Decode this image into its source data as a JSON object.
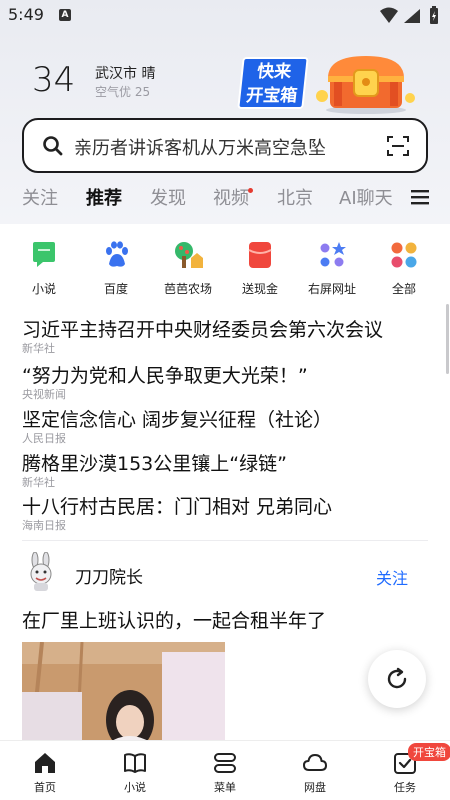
{
  "status_bar": {
    "time": "5:49",
    "notification_letter": "A"
  },
  "weather": {
    "temperature": "34",
    "city_condition": "武汉市 晴",
    "air_quality": "空气优 25"
  },
  "promo": {
    "text_line1": "快来",
    "text_line2": "开宝箱"
  },
  "search": {
    "query": "亲历者讲诉客机从万米高空急坠"
  },
  "tabs": [
    {
      "label": "关注"
    },
    {
      "label": "推荐"
    },
    {
      "label": "发现"
    },
    {
      "label": "视频"
    },
    {
      "label": "北京"
    },
    {
      "label": "AI聊天"
    }
  ],
  "active_tab": "推荐",
  "shortcuts": [
    {
      "label": "小说",
      "icon": "novel-icon"
    },
    {
      "label": "百度",
      "icon": "baidu-paw-icon"
    },
    {
      "label": "芭芭农场",
      "icon": "farm-tree-icon"
    },
    {
      "label": "送现金",
      "icon": "cash-envelope-icon"
    },
    {
      "label": "右屏网址",
      "icon": "sites-grid-icon"
    },
    {
      "label": "全部",
      "icon": "all-apps-icon"
    }
  ],
  "headlines": [
    {
      "title": "习近平主持召开中央财经委员会第六次会议",
      "source": "新华社"
    },
    {
      "title": "“努力为党和人民争取更大光荣！”",
      "source": "央视新闻"
    },
    {
      "title": "坚定信念信心 阔步复兴征程（社论）",
      "source": "人民日报"
    },
    {
      "title": "腾格里沙漠153公里镶上“绿链”",
      "source": "新华社"
    },
    {
      "title": "十八行村古民居：门门相对 兄弟同心",
      "source": "海南日报"
    }
  ],
  "feed_post": {
    "author": "刀刀院长",
    "follow_label": "关注",
    "text": "在厂里上班认识的，一起合租半年了"
  },
  "bottom_nav": [
    {
      "label": "首页",
      "icon": "home-icon"
    },
    {
      "label": "小说",
      "icon": "book-icon"
    },
    {
      "label": "菜单",
      "icon": "menu-stack-icon"
    },
    {
      "label": "网盘",
      "icon": "cloud-icon"
    },
    {
      "label": "任务",
      "icon": "task-check-icon"
    }
  ],
  "task_badge": "开宝箱",
  "colors": {
    "accent_blue": "#1f6bff",
    "badge_red": "#f0473d",
    "promo_blue": "#1f63e8"
  }
}
